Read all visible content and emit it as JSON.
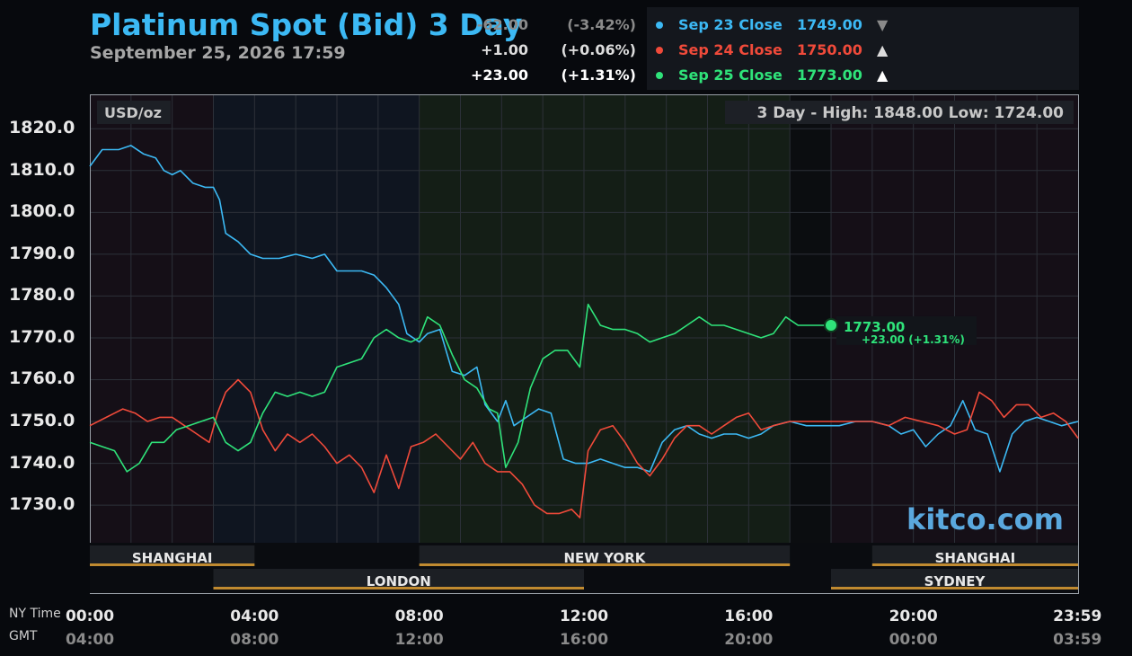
{
  "header": {
    "title": "Platinum Spot (Bid) 3 Day",
    "subtitle": "September 25, 2026 17:59"
  },
  "legend": [
    {
      "label": "Sep 23 Close",
      "value": "1749.00",
      "arrow": "▼",
      "change": "-62.00",
      "pct": "(-3.42%)",
      "color": "#3cb9f4",
      "change_color": "#8a8a8a"
    },
    {
      "label": "Sep 24 Close",
      "value": "1750.00",
      "arrow": "▲",
      "change": "+1.00",
      "pct": "(+0.06%)",
      "color": "#f04a3a",
      "change_color": "#dcdcdc"
    },
    {
      "label": "Sep 25 Close",
      "value": "1773.00",
      "arrow": "▲",
      "change": "+23.00",
      "pct": "(+1.31%)",
      "color": "#2fe37a",
      "change_color": "#ffffff"
    }
  ],
  "plot": {
    "unit_label": "USD/oz",
    "range_label": "3 Day - High: 1848.00  Low: 1724.00",
    "watermark": "kitco.com",
    "last_value_label": "1773.00",
    "last_change_label": "+23.00 (+1.31%)"
  },
  "sessions": [
    {
      "name": "SHANGHAI",
      "start": 0,
      "end": 4,
      "row": 1
    },
    {
      "name": "NEW YORK",
      "start": 8,
      "end": 17,
      "row": 1
    },
    {
      "name": "SHANGHAI",
      "start": 19,
      "end": 24,
      "row": 1
    },
    {
      "name": "LONDON",
      "start": 3,
      "end": 12,
      "row": 2
    },
    {
      "name": "SYDNEY",
      "start": 18,
      "end": 24,
      "row": 2
    }
  ],
  "x_axis": {
    "row_labels": [
      "NY Time",
      "GMT"
    ],
    "ny_ticks": [
      {
        "hour": 0,
        "label": "00:00"
      },
      {
        "hour": 4,
        "label": "04:00"
      },
      {
        "hour": 8,
        "label": "08:00"
      },
      {
        "hour": 12,
        "label": "12:00"
      },
      {
        "hour": 16,
        "label": "16:00"
      },
      {
        "hour": 20,
        "label": "20:00"
      },
      {
        "hour": 23.983,
        "label": "23:59"
      }
    ],
    "gmt_ticks": [
      "04:00",
      "08:00",
      "12:00",
      "16:00",
      "20:00",
      "00:00",
      "03:59"
    ]
  },
  "chart_data": {
    "type": "line",
    "title": "Platinum Spot (Bid) 3 Day",
    "ylabel": "USD/oz",
    "xlabel": "NY Time",
    "x_unit": "hour",
    "xlim": [
      0,
      24
    ],
    "ylim": [
      1721,
      1828
    ],
    "y_ticks": [
      1820,
      1810,
      1800,
      1790,
      1780,
      1770,
      1760,
      1750,
      1740,
      1730
    ],
    "grid": true,
    "legend_position": "top-right",
    "series": [
      {
        "name": "Sep 23 Close",
        "color": "#3cb9f4",
        "x": [
          0,
          0.3,
          0.7,
          1.0,
          1.3,
          1.6,
          1.8,
          2.0,
          2.2,
          2.5,
          2.8,
          3.0,
          3.15,
          3.3,
          3.6,
          3.9,
          4.2,
          4.6,
          5.0,
          5.4,
          5.7,
          6.0,
          6.2,
          6.6,
          6.9,
          7.2,
          7.5,
          7.7,
          8.0,
          8.2,
          8.5,
          8.8,
          9.1,
          9.4,
          9.6,
          9.9,
          10.1,
          10.3,
          10.6,
          10.9,
          11.2,
          11.5,
          11.8,
          12.1,
          12.4,
          12.7,
          13.0,
          13.3,
          13.6,
          13.9,
          14.2,
          14.5,
          14.8,
          15.1,
          15.4,
          15.7,
          16.0,
          16.3,
          16.6,
          17.0,
          17.4,
          17.8,
          18.2,
          18.6,
          19.0,
          19.4,
          19.7,
          20.0,
          20.3,
          20.6,
          20.9,
          21.2,
          21.5,
          21.8,
          22.1,
          22.4,
          22.7,
          23.0,
          23.3,
          23.6,
          24.0
        ],
        "y": [
          1811,
          1815,
          1815,
          1816,
          1814,
          1813,
          1810,
          1809,
          1810,
          1807,
          1806,
          1806,
          1803,
          1795,
          1793,
          1790,
          1789,
          1789,
          1790,
          1789,
          1790,
          1786,
          1786,
          1786,
          1785,
          1782,
          1778,
          1771,
          1769,
          1771,
          1772,
          1762,
          1761,
          1763,
          1754,
          1750,
          1755,
          1749,
          1751,
          1753,
          1752,
          1741,
          1740,
          1740,
          1741,
          1740,
          1739,
          1739,
          1738,
          1745,
          1748,
          1749,
          1747,
          1746,
          1747,
          1747,
          1746,
          1747,
          1749,
          1750,
          1749,
          1749,
          1749,
          1750,
          1750,
          1749,
          1747,
          1748,
          1744,
          1747,
          1749,
          1755,
          1748,
          1747,
          1738,
          1747,
          1750,
          1751,
          1750,
          1749,
          1750
        ]
      },
      {
        "name": "Sep 24 Close",
        "color": "#f04a3a",
        "x": [
          0,
          0.4,
          0.8,
          1.1,
          1.4,
          1.7,
          2.0,
          2.3,
          2.6,
          2.9,
          3.1,
          3.3,
          3.6,
          3.9,
          4.2,
          4.5,
          4.8,
          5.1,
          5.4,
          5.7,
          6.0,
          6.3,
          6.6,
          6.9,
          7.2,
          7.5,
          7.8,
          8.1,
          8.4,
          8.7,
          9.0,
          9.3,
          9.6,
          9.9,
          10.2,
          10.5,
          10.8,
          11.1,
          11.4,
          11.7,
          11.9,
          12.1,
          12.4,
          12.7,
          13.0,
          13.3,
          13.6,
          13.9,
          14.2,
          14.5,
          14.8,
          15.1,
          15.4,
          15.7,
          16.0,
          16.3,
          16.6,
          17.0,
          17.4,
          17.8,
          18.2,
          18.6,
          19.0,
          19.4,
          19.8,
          20.2,
          20.6,
          21.0,
          21.3,
          21.6,
          21.9,
          22.2,
          22.5,
          22.8,
          23.1,
          23.4,
          23.7,
          24.0
        ],
        "y": [
          1749,
          1751,
          1753,
          1752,
          1750,
          1751,
          1751,
          1749,
          1747,
          1745,
          1752,
          1757,
          1760,
          1757,
          1748,
          1743,
          1747,
          1745,
          1747,
          1744,
          1740,
          1742,
          1739,
          1733,
          1742,
          1734,
          1744,
          1745,
          1747,
          1744,
          1741,
          1745,
          1740,
          1738,
          1738,
          1735,
          1730,
          1728,
          1728,
          1729,
          1727,
          1743,
          1748,
          1749,
          1745,
          1740,
          1737,
          1741,
          1746,
          1749,
          1749,
          1747,
          1749,
          1751,
          1752,
          1748,
          1749,
          1750,
          1750,
          1750,
          1750,
          1750,
          1750,
          1749,
          1751,
          1750,
          1749,
          1747,
          1748,
          1757,
          1755,
          1751,
          1754,
          1754,
          1751,
          1752,
          1750,
          1746
        ]
      },
      {
        "name": "Sep 25 Close",
        "color": "#2fe37a",
        "x": [
          0,
          0.3,
          0.6,
          0.9,
          1.2,
          1.5,
          1.8,
          2.1,
          2.4,
          2.7,
          3.0,
          3.3,
          3.6,
          3.9,
          4.2,
          4.5,
          4.8,
          5.1,
          5.4,
          5.7,
          6.0,
          6.3,
          6.6,
          6.9,
          7.2,
          7.5,
          7.8,
          8.0,
          8.2,
          8.5,
          8.8,
          9.1,
          9.4,
          9.7,
          9.9,
          10.1,
          10.4,
          10.7,
          11.0,
          11.3,
          11.6,
          11.9,
          12.1,
          12.4,
          12.7,
          13.0,
          13.3,
          13.6,
          13.9,
          14.2,
          14.5,
          14.8,
          15.1,
          15.4,
          15.7,
          16.0,
          16.3,
          16.6,
          16.9,
          17.2,
          17.6,
          18.0
        ],
        "y": [
          1745,
          1744,
          1743,
          1738,
          1740,
          1745,
          1745,
          1748,
          1749,
          1750,
          1751,
          1745,
          1743,
          1745,
          1752,
          1757,
          1756,
          1757,
          1756,
          1757,
          1763,
          1764,
          1765,
          1770,
          1772,
          1770,
          1769,
          1770,
          1775,
          1773,
          1766,
          1760,
          1758,
          1753,
          1752,
          1739,
          1745,
          1758,
          1765,
          1767,
          1767,
          1763,
          1778,
          1773,
          1772,
          1772,
          1771,
          1769,
          1770,
          1771,
          1773,
          1775,
          1773,
          1773,
          1772,
          1771,
          1770,
          1771,
          1775,
          1773,
          1773,
          1773
        ]
      }
    ]
  }
}
